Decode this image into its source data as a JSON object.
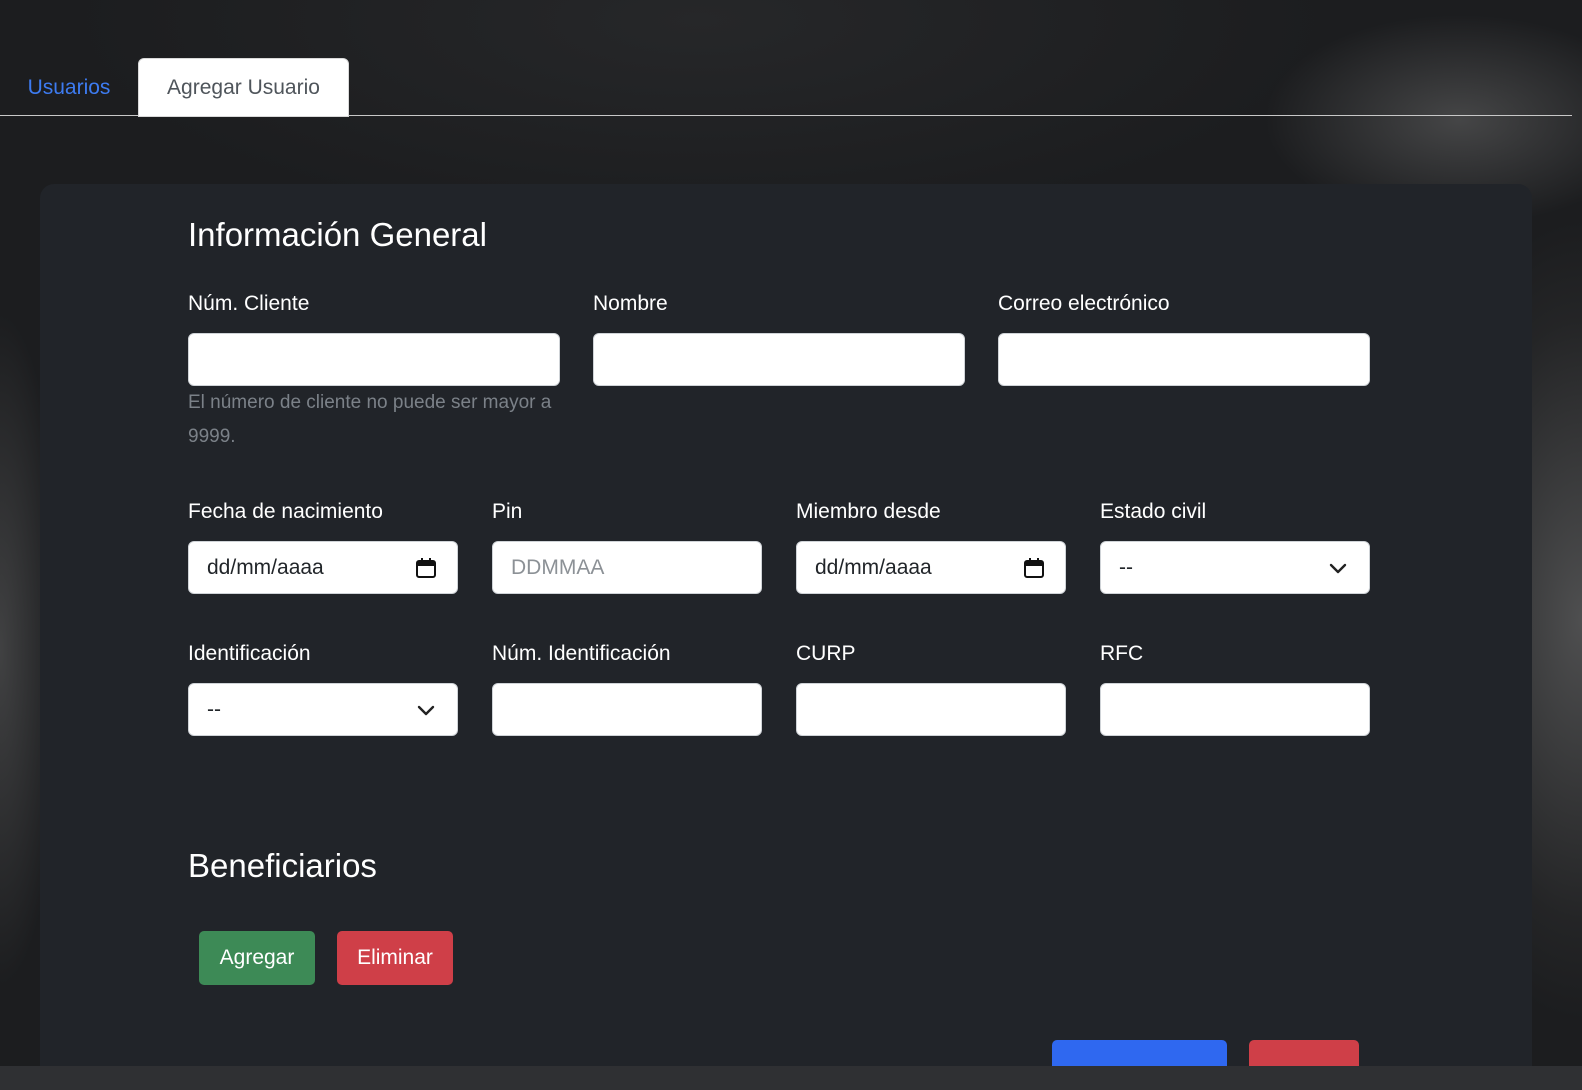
{
  "tabs": {
    "users": "Usuarios",
    "add_user": "Agregar Usuario"
  },
  "general": {
    "title": "Información General",
    "client_number": {
      "label": "Núm. Cliente",
      "value": "",
      "help": "El número de cliente no puede ser mayor a 9999."
    },
    "name": {
      "label": "Nombre",
      "value": ""
    },
    "email": {
      "label": "Correo electrónico",
      "value": ""
    },
    "birth_date": {
      "label": "Fecha de nacimiento",
      "value": "dd/mm/aaaa"
    },
    "pin": {
      "label": "Pin",
      "placeholder": "DDMMAA"
    },
    "member_since": {
      "label": "Miembro desde",
      "value": "dd/mm/aaaa"
    },
    "marital_status": {
      "label": "Estado civil",
      "selected": "--"
    },
    "identification": {
      "label": "Identificación",
      "selected": "--"
    },
    "id_number": {
      "label": "Núm. Identificación",
      "value": ""
    },
    "curp": {
      "label": "CURP",
      "value": ""
    },
    "rfc": {
      "label": "RFC",
      "value": ""
    }
  },
  "beneficiaries": {
    "title": "Beneficiarios",
    "add_label": "Agregar",
    "delete_label": "Eliminar"
  },
  "icons": {
    "calendar": "calendar-icon",
    "chevron": "chevron-down-icon"
  },
  "colors": {
    "link": "#3d7bf0",
    "success": "#3d8a56",
    "danger": "#cf3f48",
    "primary": "#2f68f0",
    "card": "#212429"
  }
}
